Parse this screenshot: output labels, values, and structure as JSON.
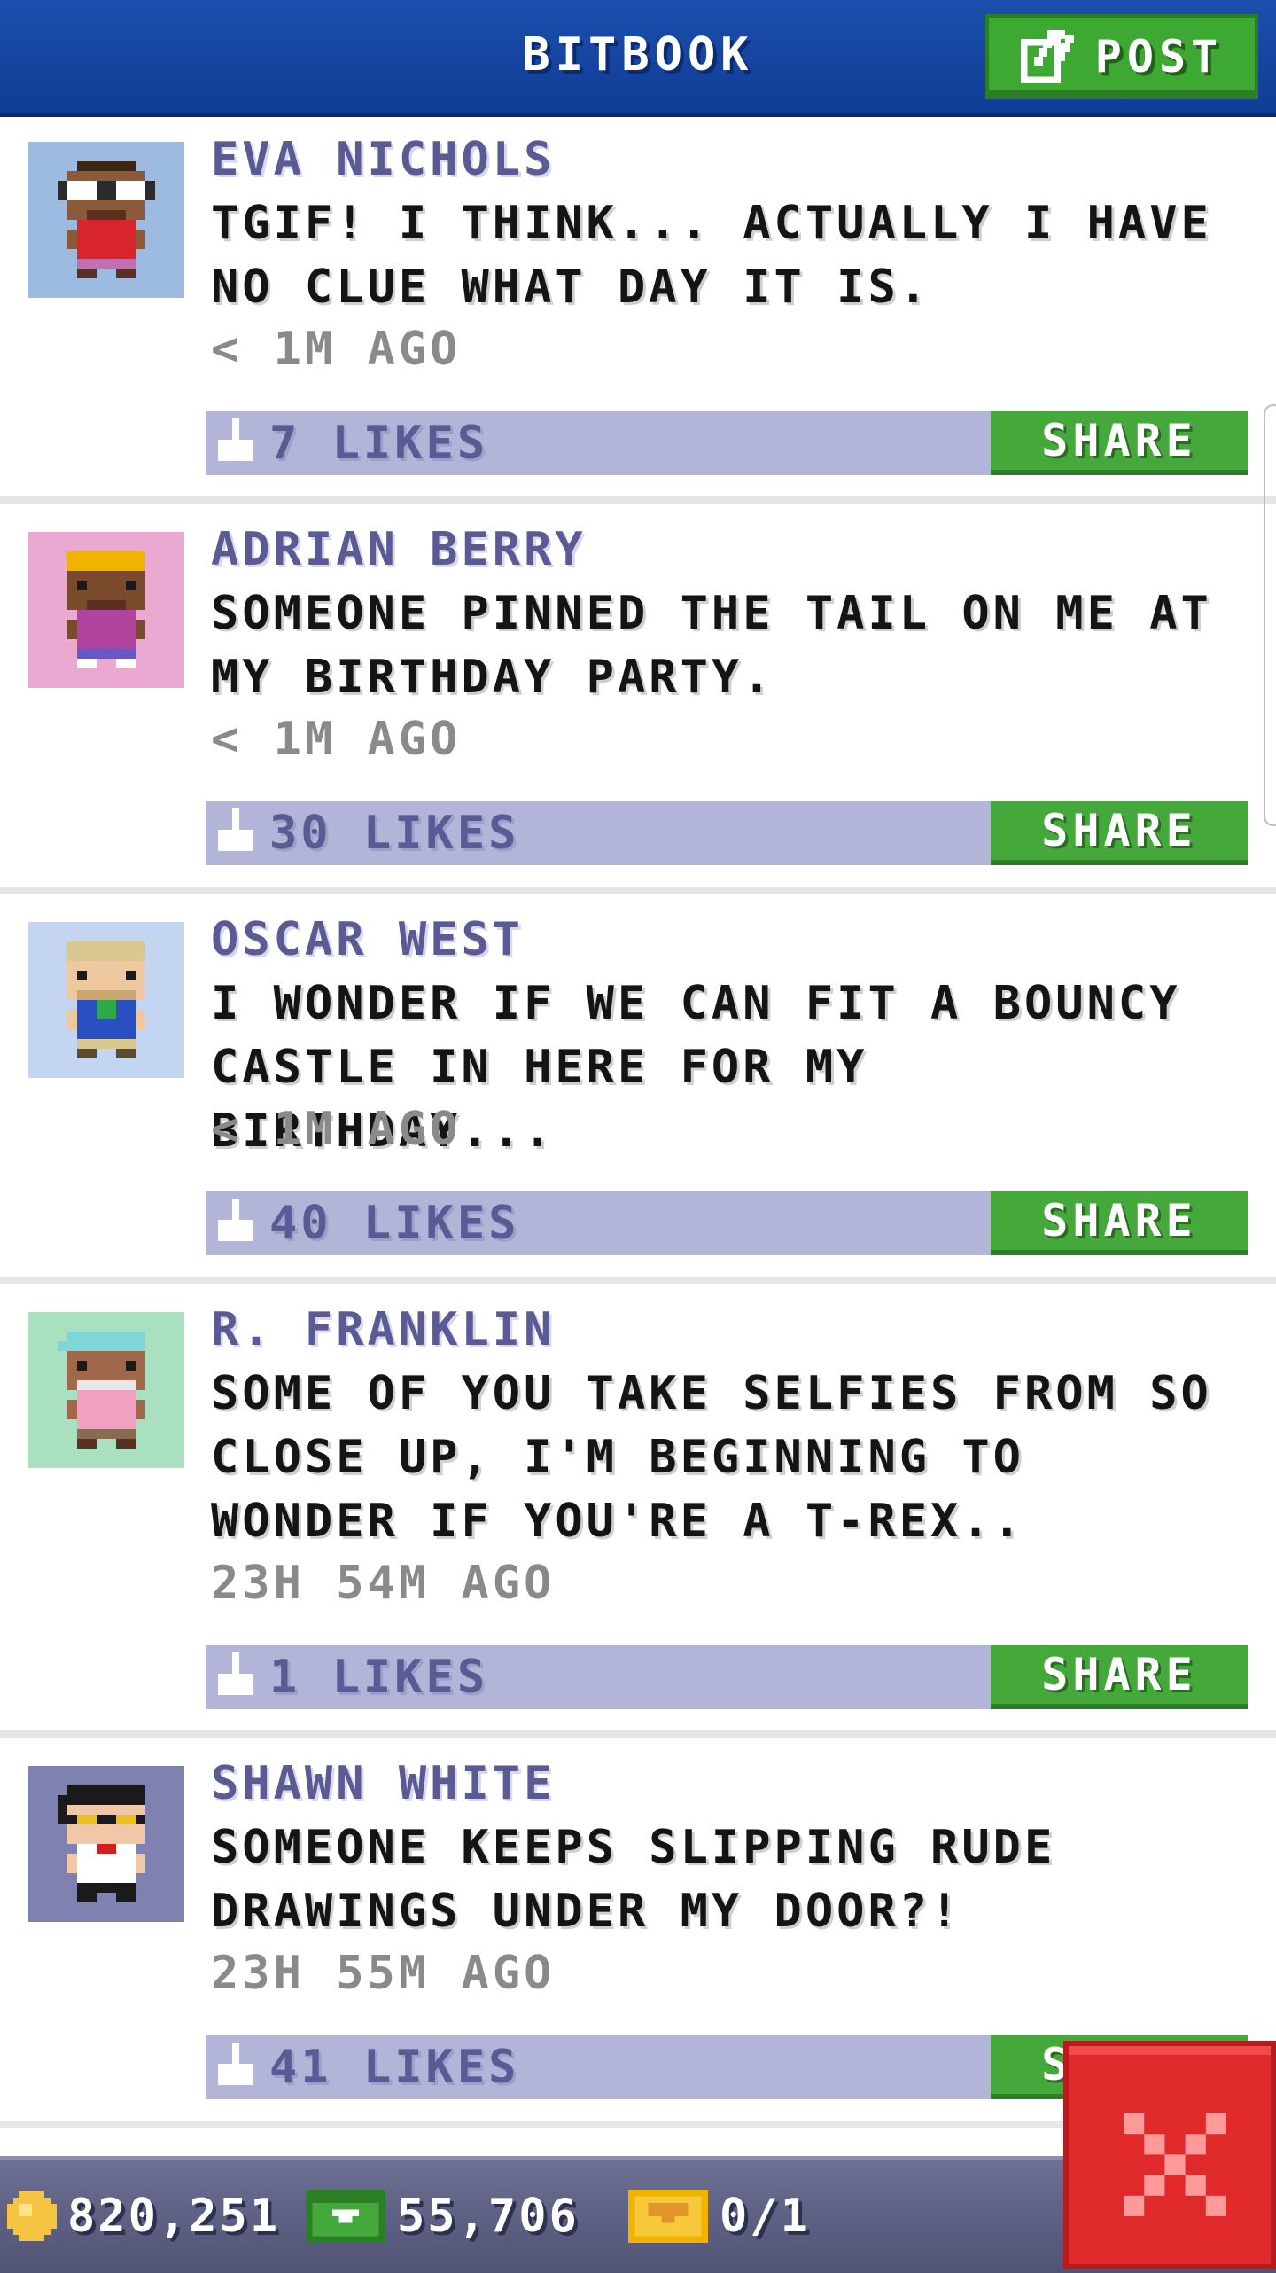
{
  "header": {
    "title": "BITBOOK",
    "post_label": "POST"
  },
  "posts": [
    {
      "name": "EVA NICHOLS",
      "text": "TGIF! I THINK... ACTUALLY I HAVE NO CLUE WHAT DAY IT IS.",
      "time": "< 1M AGO",
      "likes": "7 LIKES",
      "share_label": "SHARE",
      "avatar_bg": "#9dbbe0"
    },
    {
      "name": "ADRIAN BERRY",
      "text": "SOMEONE PINNED THE TAIL ON ME AT MY BIRTHDAY PARTY.",
      "time": "< 1M AGO",
      "likes": "30 LIKES",
      "share_label": "SHARE",
      "avatar_bg": "#e9a9d0"
    },
    {
      "name": "OSCAR WEST",
      "text": "I WONDER IF WE CAN FIT A BOUNCY CASTLE IN HERE FOR MY BIRTHDAY...",
      "time": "< 1M AGO",
      "likes": "40 LIKES",
      "share_label": "SHARE",
      "avatar_bg": "#c3d5f0"
    },
    {
      "name": "R. FRANKLIN",
      "text": "SOME OF YOU TAKE SELFIES FROM SO CLOSE UP, I'M BEGINNING TO WONDER IF YOU'RE A T-REX..",
      "time": "23H 54M AGO",
      "likes": "1 LIKES",
      "share_label": "SHARE",
      "avatar_bg": "#a9e0bf"
    },
    {
      "name": "SHAWN WHITE",
      "text": "SOMEONE KEEPS SLIPPING RUDE DRAWINGS UNDER MY DOOR?!",
      "time": "23H 55M AGO",
      "likes": "41 LIKES",
      "share_label": "SHARE",
      "avatar_bg": "#7f82b0"
    }
  ],
  "status": {
    "coins": "820,251",
    "bux": "55,706",
    "tickets": "0/1"
  },
  "colors": {
    "header": "#1c4fae",
    "accent_green": "#44a83a",
    "like_bar": "#b3b5d8",
    "close_red": "#e0292b"
  },
  "icons": [
    "post-edit-icon",
    "thumbs-up-icon",
    "coin-icon",
    "bux-icon",
    "ticket-icon",
    "close-x-icon"
  ]
}
